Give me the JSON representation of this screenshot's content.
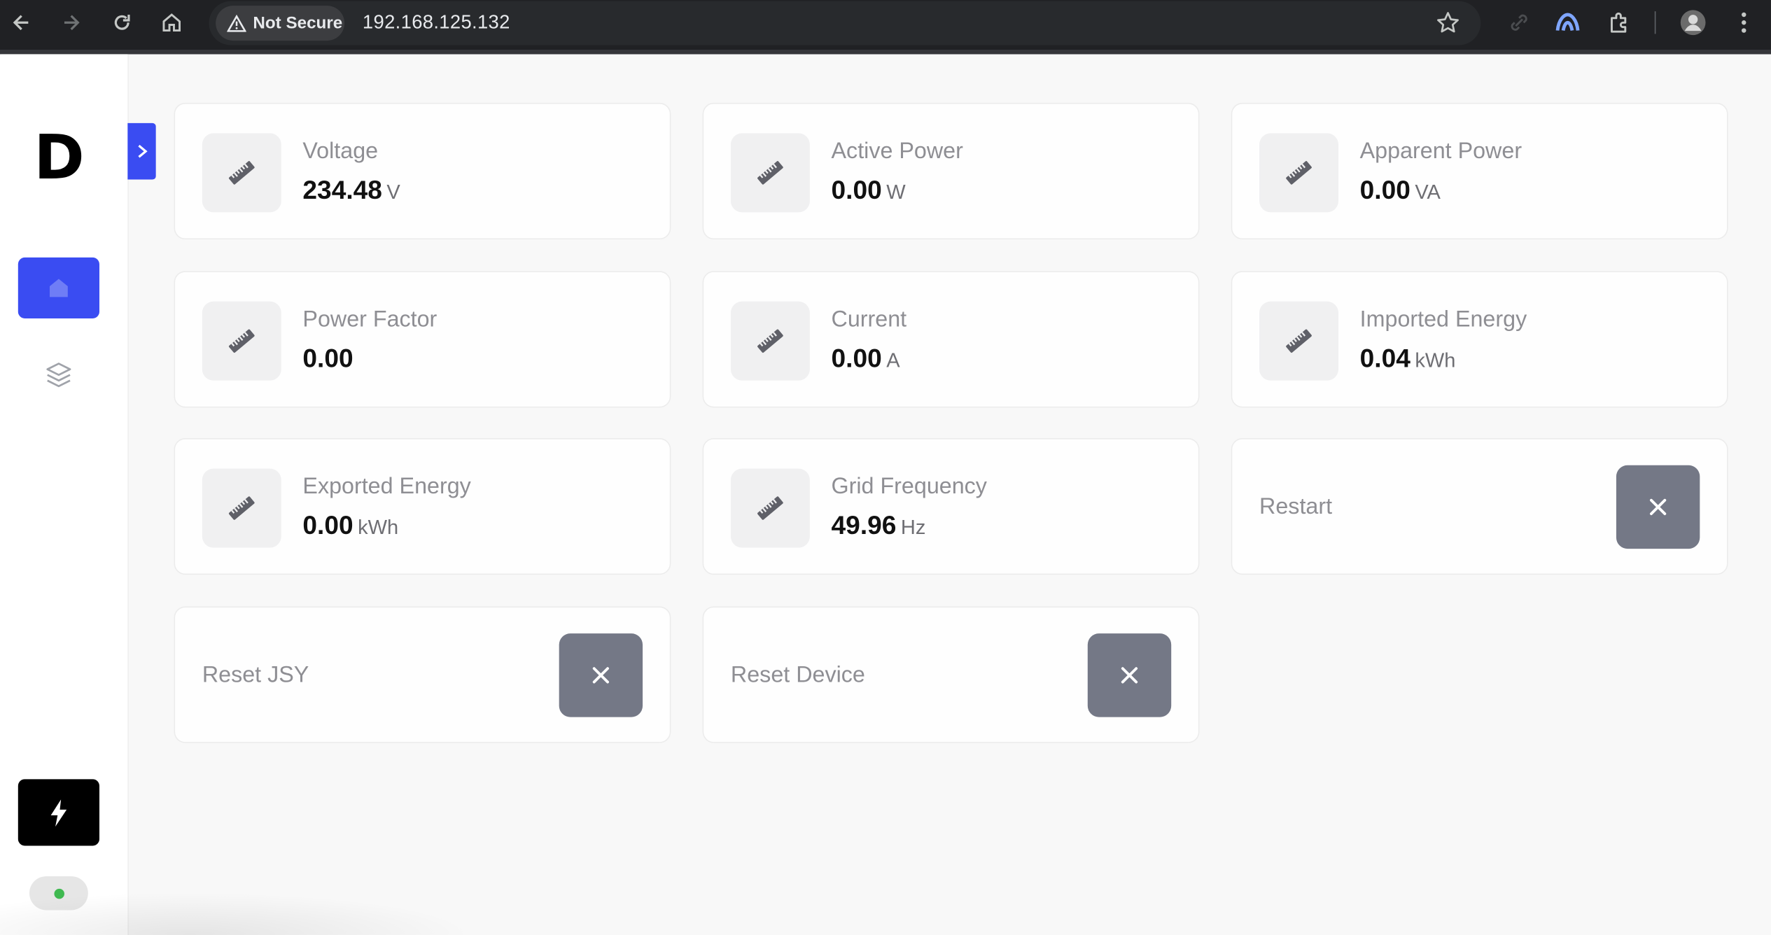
{
  "browser": {
    "security_label": "Not Secure",
    "url": "192.168.125.132"
  },
  "sidebar": {
    "logo": "D",
    "items": [
      {
        "icon": "home-icon",
        "active": true
      },
      {
        "icon": "layers-icon",
        "active": false
      }
    ],
    "action_icon": "bolt-icon",
    "status": "online"
  },
  "metrics": [
    {
      "label": "Voltage",
      "value": "234.48",
      "unit": "V"
    },
    {
      "label": "Active Power",
      "value": "0.00",
      "unit": "W"
    },
    {
      "label": "Apparent Power",
      "value": "0.00",
      "unit": "VA"
    },
    {
      "label": "Power Factor",
      "value": "0.00",
      "unit": ""
    },
    {
      "label": "Current",
      "value": "0.00",
      "unit": "A"
    },
    {
      "label": "Imported Energy",
      "value": "0.04",
      "unit": "kWh"
    },
    {
      "label": "Exported Energy",
      "value": "0.00",
      "unit": "kWh"
    },
    {
      "label": "Grid Frequency",
      "value": "49.96",
      "unit": "Hz"
    }
  ],
  "actions": {
    "restart": "Restart",
    "reset_jsy": "Reset JSY",
    "reset_device": "Reset Device"
  },
  "colors": {
    "accent": "#3a4cf2",
    "action_button": "#747886",
    "status_online": "#3fb950"
  }
}
